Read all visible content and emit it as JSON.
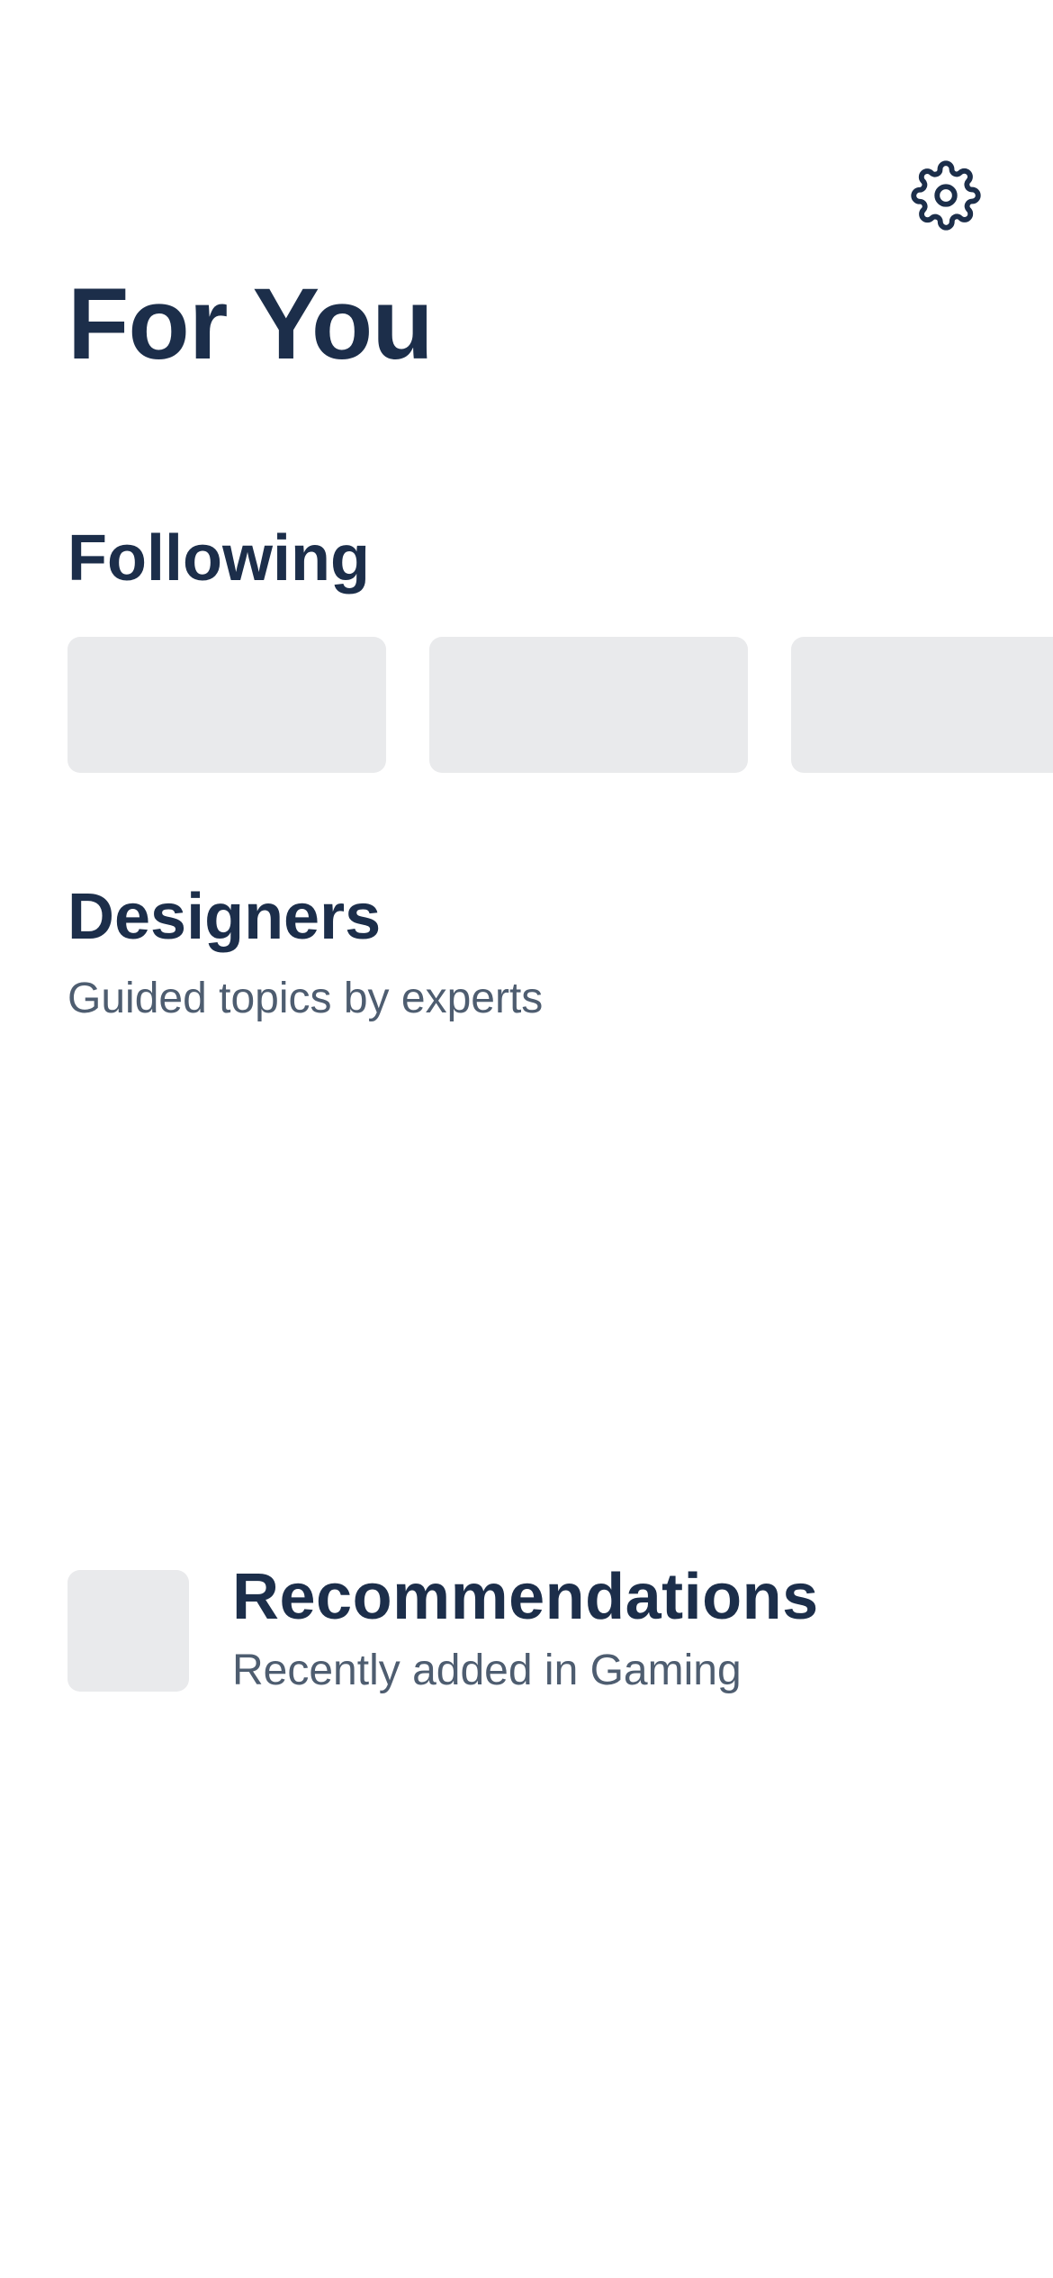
{
  "header": {
    "title": "For You",
    "settings_icon": "gear-icon"
  },
  "following": {
    "title": "Following",
    "cards": [
      {
        "state": "placeholder"
      },
      {
        "state": "placeholder"
      },
      {
        "state": "placeholder"
      }
    ]
  },
  "designers": {
    "title": "Designers",
    "subtitle": "Guided topics by experts"
  },
  "recommendations": {
    "title": "Recommendations",
    "subtitle": "Recently added in Gaming",
    "thumbnail": "placeholder"
  },
  "colors": {
    "text_primary": "#1c2e4a",
    "text_secondary": "#4e5d70",
    "placeholder": "#e9eaec",
    "background": "#ffffff"
  }
}
